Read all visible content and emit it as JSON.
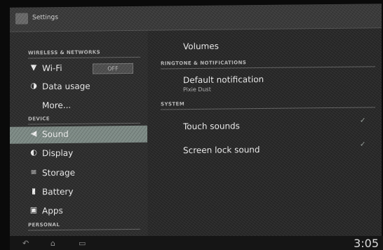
{
  "titlebar": {
    "title": "Settings"
  },
  "sections": {
    "wireless": "WIRELESS & NETWORKS",
    "device": "DEVICE",
    "personal": "PERSONAL"
  },
  "left_items": {
    "wifi": {
      "label": "Wi-Fi",
      "toggle": "OFF"
    },
    "data_usage": {
      "label": "Data usage"
    },
    "more": {
      "label": "More..."
    },
    "sound": {
      "label": "Sound"
    },
    "display": {
      "label": "Display"
    },
    "storage": {
      "label": "Storage"
    },
    "battery": {
      "label": "Battery"
    },
    "apps": {
      "label": "Apps"
    }
  },
  "right_pane": {
    "volumes": "Volumes",
    "ringtone_section": "RINGTONE & NOTIFICATIONS",
    "default_notification": {
      "title": "Default notification",
      "subtitle": "Pixie Dust"
    },
    "system_section": "SYSTEM",
    "touch_sounds": "Touch sounds",
    "screen_lock_sound": "Screen lock sound"
  },
  "statusbar": {
    "time": "3:05"
  },
  "colors": {
    "selected_bg": "#7e8b86",
    "text": "#efefef",
    "pane_bg": "#2b2b2b"
  },
  "icons": {
    "wifi": "wifi-icon",
    "data_usage": "data-usage-icon",
    "sound": "speaker-icon",
    "display": "display-icon",
    "storage": "storage-icon",
    "battery": "battery-icon",
    "apps": "apps-icon",
    "nav_back": "back-icon",
    "nav_home": "home-icon",
    "nav_recent": "recent-apps-icon"
  }
}
